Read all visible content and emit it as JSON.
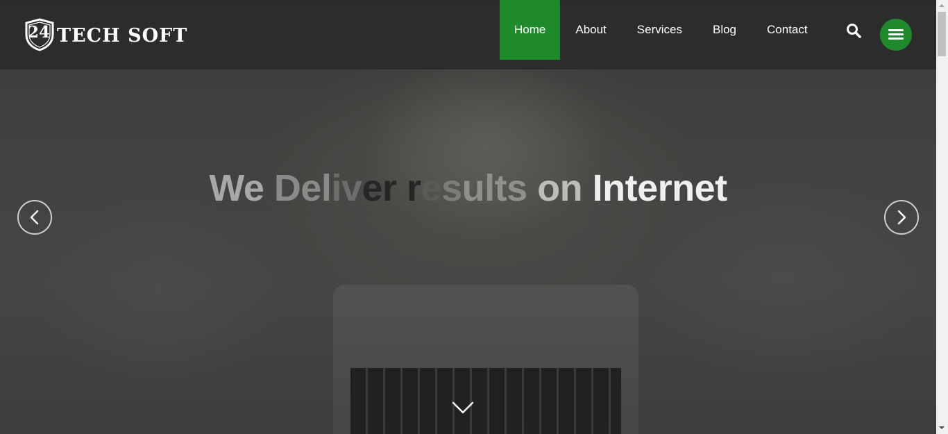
{
  "brand": {
    "shield_text": "24",
    "name": "TECH SOFT"
  },
  "nav": {
    "items": [
      {
        "label": "Home",
        "active": true
      },
      {
        "label": "About",
        "active": false
      },
      {
        "label": "Services",
        "active": false
      },
      {
        "label": "Blog",
        "active": false
      },
      {
        "label": "Contact",
        "active": false
      }
    ],
    "search_icon": "search-icon",
    "menu_icon": "hamburger-icon"
  },
  "hero": {
    "title_parts": [
      "We ",
      "Del",
      "iv",
      "er r",
      "e",
      "s",
      "ults ",
      "on ",
      "Internet"
    ],
    "prev_icon": "chevron-left-icon",
    "next_icon": "chevron-right-icon",
    "scroll_icon": "chevron-down-icon"
  },
  "colors": {
    "accent": "#1e8a2c",
    "header_bg": "#282828",
    "text": "#ffffff"
  }
}
